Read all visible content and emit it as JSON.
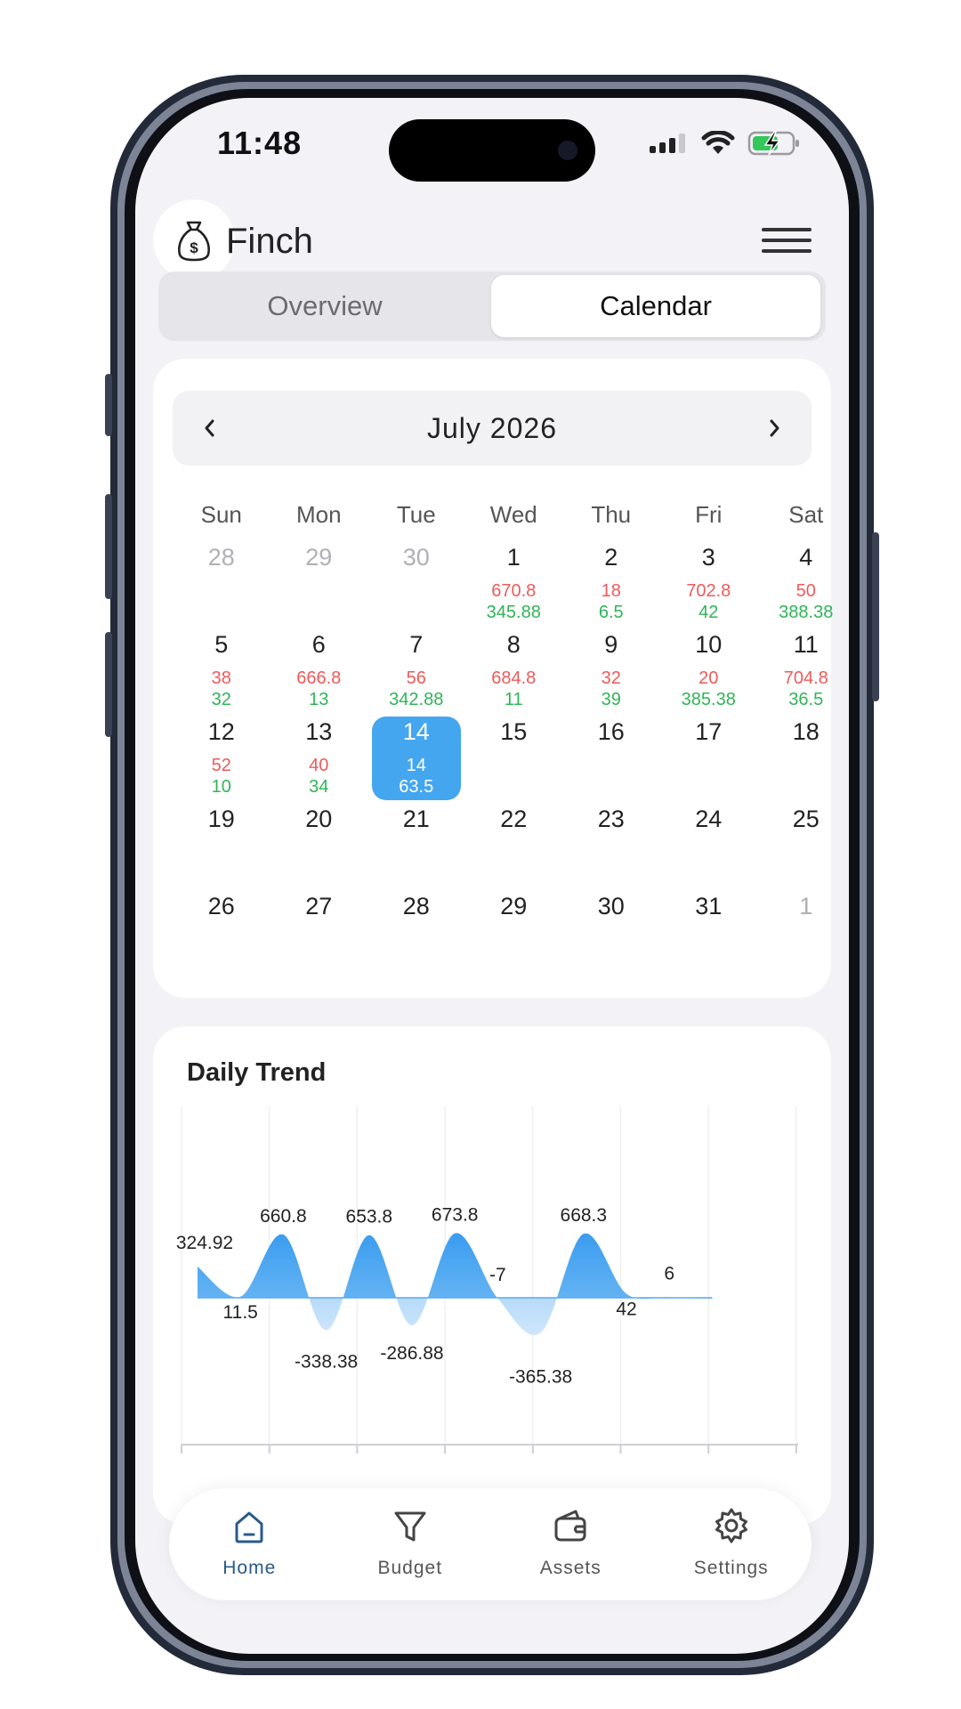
{
  "status_bar": {
    "time": "11:48"
  },
  "header": {
    "title": "Finch"
  },
  "segments": {
    "overview": "Overview",
    "calendar": "Calendar"
  },
  "calendar": {
    "month_label": "July 2026",
    "weekdays": [
      "Sun",
      "Mon",
      "Tue",
      "Wed",
      "Thu",
      "Fri",
      "Sat"
    ],
    "selected_day": 14,
    "weeks": [
      [
        {
          "day": "28",
          "muted": true
        },
        {
          "day": "29",
          "muted": true
        },
        {
          "day": "30",
          "muted": true
        },
        {
          "day": "1",
          "expense": "670.8",
          "income": "345.88"
        },
        {
          "day": "2",
          "expense": "18",
          "income": "6.5"
        },
        {
          "day": "3",
          "expense": "702.8",
          "income": "42"
        },
        {
          "day": "4",
          "expense": "50",
          "income": "388.38"
        }
      ],
      [
        {
          "day": "5",
          "expense": "38",
          "income": "32"
        },
        {
          "day": "6",
          "expense": "666.8",
          "income": "13"
        },
        {
          "day": "7",
          "expense": "56",
          "income": "342.88"
        },
        {
          "day": "8",
          "expense": "684.8",
          "income": "11"
        },
        {
          "day": "9",
          "expense": "32",
          "income": "39"
        },
        {
          "day": "10",
          "expense": "20",
          "income": "385.38"
        },
        {
          "day": "11",
          "expense": "704.8",
          "income": "36.5"
        }
      ],
      [
        {
          "day": "12",
          "expense": "52",
          "income": "10"
        },
        {
          "day": "13",
          "expense": "40",
          "income": "34"
        },
        {
          "day": "14",
          "expense": "14",
          "income": "63.5",
          "selected": true
        },
        {
          "day": "15"
        },
        {
          "day": "16"
        },
        {
          "day": "17"
        },
        {
          "day": "18"
        }
      ],
      [
        {
          "day": "19"
        },
        {
          "day": "20"
        },
        {
          "day": "21"
        },
        {
          "day": "22"
        },
        {
          "day": "23"
        },
        {
          "day": "24"
        },
        {
          "day": "25"
        }
      ],
      [
        {
          "day": "26"
        },
        {
          "day": "27"
        },
        {
          "day": "28"
        },
        {
          "day": "29"
        },
        {
          "day": "30"
        },
        {
          "day": "31"
        },
        {
          "day": "1",
          "muted": true
        }
      ]
    ]
  },
  "trend": {
    "title": "Daily Trend"
  },
  "chart_data": {
    "type": "area",
    "title": "Daily Trend",
    "x": [
      1,
      2,
      3,
      4,
      5,
      6,
      7,
      8,
      9,
      10,
      11,
      12,
      13,
      14
    ],
    "series": [
      {
        "values": [
          324.92,
          11.5,
          660.8,
          -338.38,
          653.8,
          -286.88,
          673.8,
          -7,
          -365.38,
          668.3,
          42,
          6,
          -14,
          null
        ],
        "labels": [
          "324.92",
          "11.5",
          "660.8",
          "-338.38",
          "653.8",
          "-286.88",
          "673.8",
          "-7",
          "-365.38",
          "668.3",
          "42",
          "6",
          "",
          ""
        ]
      }
    ],
    "ylim": [
      -400,
      700
    ],
    "grid": true,
    "color": "#3fa2f0"
  },
  "bottom_nav": {
    "items": [
      {
        "key": "home",
        "label": "Home",
        "icon": "home-icon",
        "active": true
      },
      {
        "key": "budget",
        "label": "Budget",
        "icon": "filter-icon",
        "active": false
      },
      {
        "key": "assets",
        "label": "Assets",
        "icon": "wallet-icon",
        "active": false
      },
      {
        "key": "settings",
        "label": "Settings",
        "icon": "gear-icon",
        "active": false
      }
    ]
  },
  "colors": {
    "accent": "#44a6ef",
    "expense": "#ee5a5a",
    "income": "#2fb556",
    "nav_active": "#2a5a8a"
  }
}
